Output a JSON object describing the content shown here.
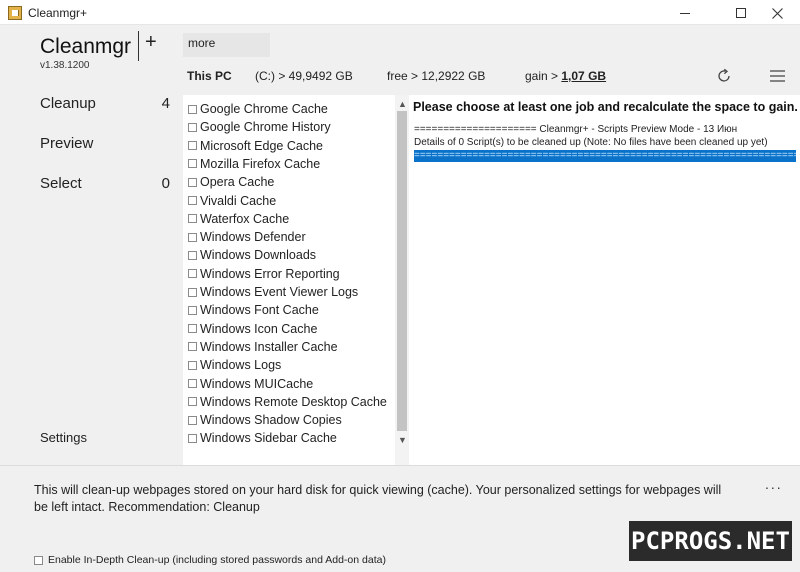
{
  "window": {
    "title": "Cleanmgr+",
    "icon": "app-icon",
    "controls": {
      "minimize": "minimize-icon",
      "maximize": "maximize-icon",
      "close": "close-icon"
    }
  },
  "sidebar": {
    "app_name": "Cleanmgr",
    "add_label": "+",
    "version": "v1.38.1200",
    "nav": [
      {
        "label": "Cleanup",
        "count": "4"
      },
      {
        "label": "Preview",
        "count": ""
      },
      {
        "label": "Select",
        "count": "0"
      }
    ],
    "settings_label": "Settings"
  },
  "tabs": [
    {
      "label": "more"
    }
  ],
  "infobar": {
    "pc_label": "This PC",
    "drive": "(C:) > 49,9492 GB",
    "free": "free > 12,2922 GB",
    "gain_label": "gain >",
    "gain_value": "1,07 GB",
    "refresh_icon": "refresh-icon",
    "menu_icon": "hamburger-menu-icon"
  },
  "scripts": [
    "Google Chrome Cache",
    "Google Chrome History",
    "Microsoft Edge Cache",
    "Mozilla Firefox Cache",
    "Opera Cache",
    "Vivaldi Cache",
    "Waterfox Cache",
    "Windows Defender",
    "Windows Downloads",
    "Windows Error Reporting",
    "Windows Event Viewer Logs",
    "Windows Font Cache",
    "Windows Icon Cache",
    "Windows Installer Cache",
    "Windows Logs",
    "Windows MUICache",
    "Windows Remote Desktop Cache",
    "Windows Shadow Copies",
    "Windows Sidebar Cache"
  ],
  "preview": {
    "heading": "Please choose at least one job and recalculate the space to gain.",
    "line1": "===================== Cleanmgr+ - Scripts Preview Mode - 13 Июн",
    "line2": "Details of 0 Script(s) to be cleaned up (Note: No files have been cleaned up yet)",
    "line3": "=========================================================================="
  },
  "bottom": {
    "description": "This will clean-up webpages stored on your hard disk for quick viewing (cache). Your personalized settings for webpages will be left intact. Recommendation: Cleanup",
    "more_label": "...",
    "indepth_label": "Enable In-Depth Clean-up (including stored passwords and Add-on data)"
  },
  "watermark": "PCPROGS.NET",
  "colors": {
    "selection": "#0a72c9",
    "watermark_bg": "#2b2b2b"
  }
}
